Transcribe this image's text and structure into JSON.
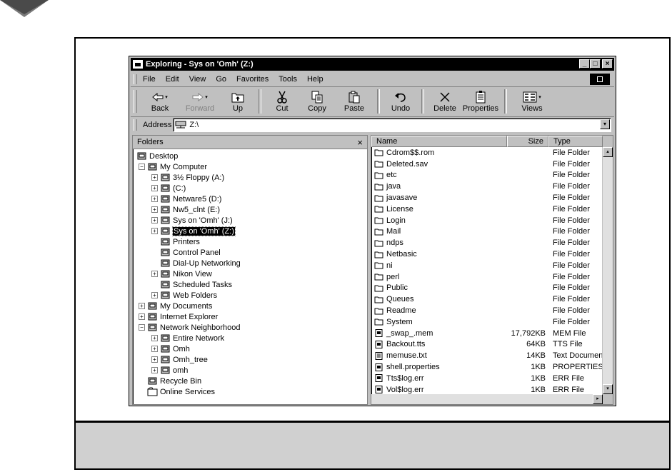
{
  "window": {
    "title": "Exploring - Sys on 'Omh' (Z:)",
    "min_glyph": "_",
    "max_glyph": "□",
    "close_glyph": "×"
  },
  "menu": [
    "File",
    "Edit",
    "View",
    "Go",
    "Favorites",
    "Tools",
    "Help"
  ],
  "toolbar": {
    "back": "Back",
    "forward": "Forward",
    "up": "Up",
    "cut": "Cut",
    "copy": "Copy",
    "paste": "Paste",
    "undo": "Undo",
    "delete": "Delete",
    "properties": "Properties",
    "views": "Views",
    "dropdown_glyph": "▾"
  },
  "address": {
    "label": "Address",
    "value": "Z:\\"
  },
  "folders": {
    "title": "Folders",
    "close_glyph": "×",
    "tree": [
      {
        "label": "Desktop",
        "level": 0,
        "pm": "",
        "icon": "desktop-icon"
      },
      {
        "label": "My Computer",
        "level": 1,
        "pm": "−",
        "icon": "computer-icon"
      },
      {
        "label": "3½ Floppy (A:)",
        "level": 2,
        "pm": "+",
        "icon": "floppy-icon"
      },
      {
        "label": "(C:)",
        "level": 2,
        "pm": "+",
        "icon": "drive-icon"
      },
      {
        "label": "Netware5 (D:)",
        "level": 2,
        "pm": "+",
        "icon": "network-drive-icon"
      },
      {
        "label": "Nw5_clnt (E:)",
        "level": 2,
        "pm": "+",
        "icon": "cd-drive-icon"
      },
      {
        "label": "Sys on 'Omh' (J:)",
        "level": 2,
        "pm": "+",
        "icon": "network-drive-icon"
      },
      {
        "label": "Sys on 'Omh' (Z:)",
        "level": 2,
        "pm": "+",
        "icon": "network-drive-icon",
        "selected": true
      },
      {
        "label": "Printers",
        "level": 2,
        "pm": "",
        "icon": "printer-folder-icon"
      },
      {
        "label": "Control Panel",
        "level": 2,
        "pm": "",
        "icon": "control-panel-icon"
      },
      {
        "label": "Dial-Up Networking",
        "level": 2,
        "pm": "",
        "icon": "dialup-icon"
      },
      {
        "label": "Nikon View",
        "level": 2,
        "pm": "+",
        "icon": "camera-icon"
      },
      {
        "label": "Scheduled Tasks",
        "level": 2,
        "pm": "",
        "icon": "tasks-icon"
      },
      {
        "label": "Web Folders",
        "level": 2,
        "pm": "+",
        "icon": "web-folder-icon"
      },
      {
        "label": "My Documents",
        "level": 1,
        "pm": "+",
        "icon": "documents-icon"
      },
      {
        "label": "Internet Explorer",
        "level": 1,
        "pm": "+",
        "icon": "ie-icon"
      },
      {
        "label": "Network Neighborhood",
        "level": 1,
        "pm": "−",
        "icon": "network-icon"
      },
      {
        "label": "Entire Network",
        "level": 2,
        "pm": "+",
        "icon": "globe-icon"
      },
      {
        "label": "Omh",
        "level": 2,
        "pm": "+",
        "icon": "server-icon"
      },
      {
        "label": "Omh_tree",
        "level": 2,
        "pm": "+",
        "icon": "tree-icon"
      },
      {
        "label": "omh",
        "level": 2,
        "pm": "+",
        "icon": "nds-icon"
      },
      {
        "label": "Recycle Bin",
        "level": 1,
        "pm": "",
        "icon": "recycle-bin-icon"
      },
      {
        "label": "Online Services",
        "level": 1,
        "pm": "",
        "icon": "folder-icon"
      }
    ]
  },
  "files": {
    "headers": {
      "name": "Name",
      "size": "Size",
      "type": "Type"
    },
    "rows": [
      {
        "name": "Cdrom$$.rom",
        "size": "",
        "type": "File Folder",
        "kind": "folder"
      },
      {
        "name": "Deleted.sav",
        "size": "",
        "type": "File Folder",
        "kind": "folder"
      },
      {
        "name": "etc",
        "size": "",
        "type": "File Folder",
        "kind": "folder"
      },
      {
        "name": "java",
        "size": "",
        "type": "File Folder",
        "kind": "folder"
      },
      {
        "name": "javasave",
        "size": "",
        "type": "File Folder",
        "kind": "folder"
      },
      {
        "name": "License",
        "size": "",
        "type": "File Folder",
        "kind": "folder"
      },
      {
        "name": "Login",
        "size": "",
        "type": "File Folder",
        "kind": "folder"
      },
      {
        "name": "Mail",
        "size": "",
        "type": "File Folder",
        "kind": "folder"
      },
      {
        "name": "ndps",
        "size": "",
        "type": "File Folder",
        "kind": "folder"
      },
      {
        "name": "Netbasic",
        "size": "",
        "type": "File Folder",
        "kind": "folder"
      },
      {
        "name": "ni",
        "size": "",
        "type": "File Folder",
        "kind": "folder"
      },
      {
        "name": "perl",
        "size": "",
        "type": "File Folder",
        "kind": "folder"
      },
      {
        "name": "Public",
        "size": "",
        "type": "File Folder",
        "kind": "folder"
      },
      {
        "name": "Queues",
        "size": "",
        "type": "File Folder",
        "kind": "folder"
      },
      {
        "name": "Readme",
        "size": "",
        "type": "File Folder",
        "kind": "folder"
      },
      {
        "name": "System",
        "size": "",
        "type": "File Folder",
        "kind": "folder"
      },
      {
        "name": "_swap_.mem",
        "size": "17,792KB",
        "type": "MEM File",
        "kind": "file"
      },
      {
        "name": "Backout.tts",
        "size": "64KB",
        "type": "TTS File",
        "kind": "file"
      },
      {
        "name": "memuse.txt",
        "size": "14KB",
        "type": "Text Document",
        "kind": "text"
      },
      {
        "name": "shell.properties",
        "size": "1KB",
        "type": "PROPERTIES F",
        "kind": "file"
      },
      {
        "name": "Tts$log.err",
        "size": "1KB",
        "type": "ERR File",
        "kind": "file"
      },
      {
        "name": "Vol$log.err",
        "size": "1KB",
        "type": "ERR File",
        "kind": "file"
      }
    ]
  },
  "scroll": {
    "up_glyph": "▴",
    "down_glyph": "▾",
    "right_glyph": "▸"
  }
}
